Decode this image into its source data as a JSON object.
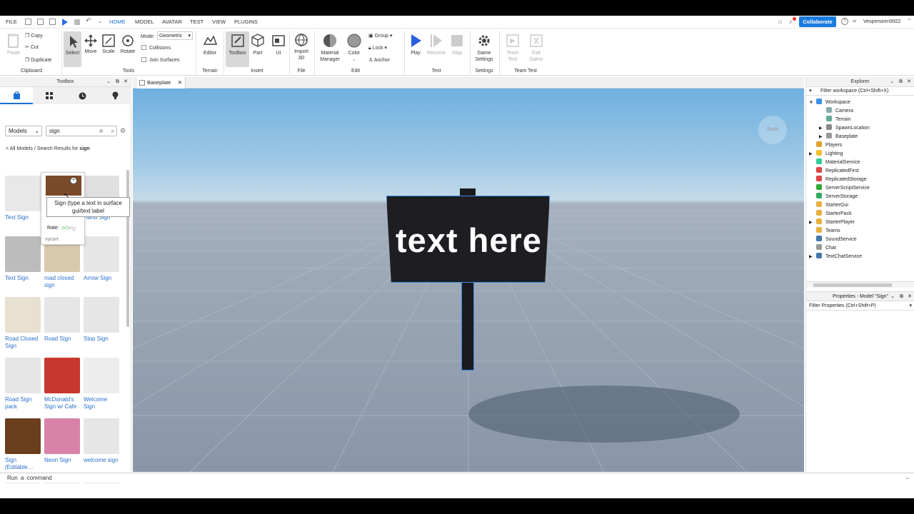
{
  "menu": {
    "file": "FILE",
    "tabs": [
      "HOME",
      "MODEL",
      "AVATAR",
      "TEST",
      "VIEW",
      "PLUGINS"
    ],
    "collaborate": "Collaborate",
    "username": "Vespersiren9922"
  },
  "ribbon": {
    "clipboard": {
      "paste": "Paste",
      "copy": "Copy",
      "cut": "Cut",
      "duplicate": "Duplicate",
      "group": "Clipboard"
    },
    "tools": {
      "select": "Select",
      "move": "Move",
      "scale": "Scale",
      "rotate": "Rotate",
      "mode_label": "Mode:",
      "mode_value": "Geometric",
      "collisions": "Collisions",
      "join_surfaces": "Join Surfaces",
      "group": "Tools"
    },
    "terrain": {
      "editor": "Editor",
      "group": "Terrain"
    },
    "insert": {
      "toolbox": "Toolbox",
      "part": "Part",
      "ui": "UI",
      "group": "Insert"
    },
    "file": {
      "import3d_line1": "Import",
      "import3d_line2": "3D",
      "group": "File"
    },
    "edit": {
      "material_line1": "Material",
      "material_line2": "Manager",
      "color": "Color",
      "grp": "Group",
      "lock": "Lock",
      "anchor": "Anchor",
      "group": "Edit"
    },
    "test": {
      "play": "Play",
      "resume": "Resume",
      "stop": "Stop",
      "group": "Test"
    },
    "settings": {
      "game_line1": "Game",
      "game_line2": "Settings",
      "group": "Settings"
    },
    "teamtest": {
      "team_line1": "Team",
      "team_line2": "Test",
      "exit_line1": "Exit",
      "exit_line2": "Game",
      "group": "Team Test"
    }
  },
  "toolbox": {
    "title": "Toolbox",
    "category": "Models",
    "search_value": "sign",
    "breadcrumb_prefix": "< All Models / Search Results for ",
    "breadcrumb_term": "sign",
    "tooltip": {
      "line1": "Sign (type a text in surface",
      "line2": "gui/text label",
      "rate": "Rate:",
      "creator": "vycort"
    },
    "items": [
      {
        "name": "Text Sign",
        "thumb": "#e8e8e8"
      },
      {
        "name": "Sign (type a",
        "thumb": "#7a4a2b"
      },
      {
        "name": "Hand Sign",
        "thumb": "#e0e0e0"
      },
      {
        "name": "Text Sign",
        "thumb": "#bcbcbc"
      },
      {
        "name": "road closed sign",
        "thumb": "#d9c9ae"
      },
      {
        "name": "Arrow Sign",
        "thumb": "#e6e6e6"
      },
      {
        "name": "Road Closed Sign",
        "thumb": "#e8e0d0"
      },
      {
        "name": "Road Sign",
        "thumb": "#e6e6e6"
      },
      {
        "name": "Stop Sign",
        "thumb": "#e6e6e6"
      },
      {
        "name": "Road Sign pack",
        "thumb": "#e6e6e6"
      },
      {
        "name": "McDonald's Sign w/ Cafe",
        "thumb": "#c8372d"
      },
      {
        "name": "Welcome Sign",
        "thumb": "#ededed"
      },
      {
        "name": "Sign (Editable…",
        "thumb": "#6b3e1e"
      },
      {
        "name": "Neon Sign",
        "thumb": "#d882a8"
      },
      {
        "name": "welcome sign",
        "thumb": "#e6e6e6"
      }
    ]
  },
  "viewport": {
    "tab": "Baseplate",
    "sign_text": "text here",
    "back": "Back"
  },
  "explorer": {
    "title": "Explorer",
    "filter": "Filter workspace (Ctrl+Shift+X)",
    "items": [
      {
        "name": "Workspace",
        "indent": 0,
        "arrow": "▼",
        "color": "#3a8ee6"
      },
      {
        "name": "Camera",
        "indent": 1,
        "arrow": "",
        "color": "#8aa"
      },
      {
        "name": "Terrain",
        "indent": 1,
        "arrow": "",
        "color": "#6a9"
      },
      {
        "name": "SpawnLocation",
        "indent": 1,
        "arrow": "▶",
        "color": "#888"
      },
      {
        "name": "Baseplate",
        "indent": 1,
        "arrow": "▶",
        "color": "#999"
      },
      {
        "name": "Players",
        "indent": 0,
        "arrow": "",
        "color": "#e0a030"
      },
      {
        "name": "Lighting",
        "indent": 0,
        "arrow": "▶",
        "color": "#f0c030"
      },
      {
        "name": "MaterialService",
        "indent": 0,
        "arrow": "",
        "color": "#3c9"
      },
      {
        "name": "ReplicatedFirst",
        "indent": 0,
        "arrow": "",
        "color": "#d44"
      },
      {
        "name": "ReplicatedStorage",
        "indent": 0,
        "arrow": "",
        "color": "#d44"
      },
      {
        "name": "ServerScriptService",
        "indent": 0,
        "arrow": "",
        "color": "#3a3"
      },
      {
        "name": "ServerStorage",
        "indent": 0,
        "arrow": "",
        "color": "#3a6"
      },
      {
        "name": "StarterGui",
        "indent": 0,
        "arrow": "",
        "color": "#e8b040"
      },
      {
        "name": "StarterPack",
        "indent": 0,
        "arrow": "",
        "color": "#e8b040"
      },
      {
        "name": "StarterPlayer",
        "indent": 0,
        "arrow": "▶",
        "color": "#e8b040"
      },
      {
        "name": "Teams",
        "indent": 0,
        "arrow": "",
        "color": "#e8b040"
      },
      {
        "name": "SoundService",
        "indent": 0,
        "arrow": "",
        "color": "#47a"
      },
      {
        "name": "Chat",
        "indent": 0,
        "arrow": "",
        "color": "#999"
      },
      {
        "name": "TextChatService",
        "indent": 0,
        "arrow": "▶",
        "color": "#47a"
      }
    ]
  },
  "properties": {
    "title": "Properties - Model \"Sign\"",
    "filter": "Filter Properties (Ctrl+Shift+P)"
  },
  "command": {
    "placeholder": "Run a command"
  }
}
